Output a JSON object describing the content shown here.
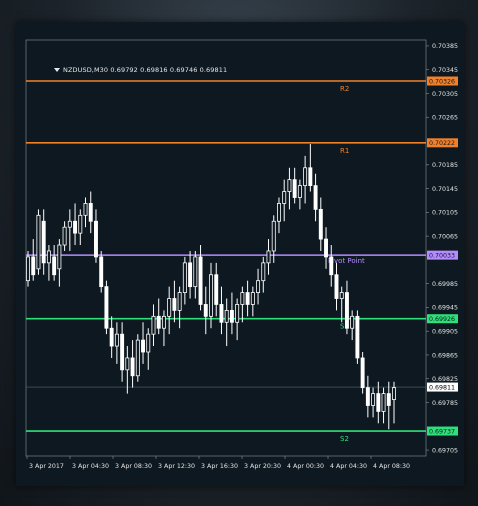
{
  "symbol": "NZDUSD,M30",
  "ohlc": [
    "0.69792",
    "0.69816",
    "0.69746",
    "0.69811"
  ],
  "colors": {
    "background": "#0d1820",
    "candle": "#ffffff",
    "resistance": "#f0812a",
    "pivot": "#b58cff",
    "support": "#2fe07a",
    "axis_text": "#e6e6e6"
  },
  "price_axis": {
    "ticks": [
      "0.70385",
      "0.70345",
      "0.70305",
      "0.70265",
      "0.70185",
      "0.70145",
      "0.70105",
      "0.70065",
      "0.69985",
      "0.69945",
      "0.69905",
      "0.69865",
      "0.69825",
      "0.69785",
      "0.69705"
    ],
    "current_price": "0.69811"
  },
  "time_axis": {
    "labels": [
      "3 Apr 2017",
      "3 Apr 04:30",
      "3 Apr 08:30",
      "3 Apr 12:30",
      "3 Apr 16:30",
      "3 Apr 20:30",
      "4 Apr 00:30",
      "4 Apr 04:30",
      "4 Apr 08:30"
    ]
  },
  "levels": [
    {
      "name": "R2",
      "label": "R2",
      "price": "0.70326",
      "type": "resistance"
    },
    {
      "name": "R1",
      "label": "R1",
      "price": "0.70222",
      "type": "resistance"
    },
    {
      "name": "pivot",
      "label": "Pivot Point",
      "price": "0.70033",
      "type": "pivot"
    },
    {
      "name": "S1",
      "label": "S1",
      "price": "0.69926",
      "type": "support"
    },
    {
      "name": "S2",
      "label": "S2",
      "price": "0.69737",
      "type": "support"
    }
  ],
  "chart_data": {
    "type": "candlestick",
    "ylim": [
      0.69695,
      0.70395
    ],
    "candles": [
      [
        0.6999,
        0.7004,
        0.6998,
        0.7003
      ],
      [
        0.7003,
        0.7006,
        0.6999,
        0.7
      ],
      [
        0.7001,
        0.7011,
        0.7,
        0.701
      ],
      [
        0.7009,
        0.7011,
        0.7,
        0.7002
      ],
      [
        0.7002,
        0.7005,
        0.6999,
        0.7004
      ],
      [
        0.7003,
        0.7005,
        0.6999,
        0.7
      ],
      [
        0.7001,
        0.7006,
        0.6998,
        0.7005
      ],
      [
        0.7005,
        0.7009,
        0.7004,
        0.7008
      ],
      [
        0.7008,
        0.7011,
        0.7004,
        0.7009
      ],
      [
        0.7009,
        0.7012,
        0.7005,
        0.7007
      ],
      [
        0.7007,
        0.7011,
        0.7005,
        0.701
      ],
      [
        0.701,
        0.7013,
        0.7008,
        0.7012
      ],
      [
        0.7012,
        0.7014,
        0.7007,
        0.7009
      ],
      [
        0.7009,
        0.7011,
        0.7002,
        0.7003
      ],
      [
        0.7003,
        0.7004,
        0.6997,
        0.6998
      ],
      [
        0.6998,
        0.6999,
        0.699,
        0.6991
      ],
      [
        0.6991,
        0.6993,
        0.6986,
        0.6988
      ],
      [
        0.6988,
        0.6992,
        0.6985,
        0.699
      ],
      [
        0.699,
        0.6992,
        0.6982,
        0.6984
      ],
      [
        0.6984,
        0.6988,
        0.698,
        0.6986
      ],
      [
        0.6986,
        0.6989,
        0.6981,
        0.6983
      ],
      [
        0.6983,
        0.699,
        0.6982,
        0.6989
      ],
      [
        0.6989,
        0.6992,
        0.6985,
        0.6987
      ],
      [
        0.6987,
        0.6991,
        0.6984,
        0.699
      ],
      [
        0.699,
        0.6995,
        0.6988,
        0.6993
      ],
      [
        0.6993,
        0.6996,
        0.699,
        0.6991
      ],
      [
        0.6991,
        0.6994,
        0.6988,
        0.6993
      ],
      [
        0.6993,
        0.6998,
        0.699,
        0.6996
      ],
      [
        0.6996,
        0.6999,
        0.6992,
        0.6994
      ],
      [
        0.6994,
        0.6998,
        0.6991,
        0.6997
      ],
      [
        0.6997,
        0.7003,
        0.6995,
        0.7002
      ],
      [
        0.7002,
        0.7004,
        0.6996,
        0.6998
      ],
      [
        0.6998,
        0.7004,
        0.6996,
        0.7003
      ],
      [
        0.7003,
        0.7005,
        0.6994,
        0.6995
      ],
      [
        0.6995,
        0.6998,
        0.699,
        0.6993
      ],
      [
        0.6993,
        0.7002,
        0.6991,
        0.7
      ],
      [
        0.7,
        0.7002,
        0.6993,
        0.6995
      ],
      [
        0.6995,
        0.6998,
        0.699,
        0.6992
      ],
      [
        0.6992,
        0.6996,
        0.6988,
        0.6994
      ],
      [
        0.6994,
        0.6997,
        0.699,
        0.6992
      ],
      [
        0.6992,
        0.6996,
        0.6989,
        0.6995
      ],
      [
        0.6995,
        0.6998,
        0.6992,
        0.6997
      ],
      [
        0.6997,
        0.6999,
        0.6993,
        0.6995
      ],
      [
        0.6995,
        0.6998,
        0.6993,
        0.6997
      ],
      [
        0.6997,
        0.7001,
        0.6995,
        0.6999
      ],
      [
        0.6999,
        0.7003,
        0.6997,
        0.7002
      ],
      [
        0.7002,
        0.7006,
        0.7,
        0.7004
      ],
      [
        0.7004,
        0.701,
        0.7002,
        0.7009
      ],
      [
        0.7009,
        0.7013,
        0.7007,
        0.7012
      ],
      [
        0.7012,
        0.7016,
        0.7009,
        0.7014
      ],
      [
        0.7014,
        0.7018,
        0.7011,
        0.7016
      ],
      [
        0.7016,
        0.7018,
        0.7012,
        0.7013
      ],
      [
        0.7013,
        0.7016,
        0.7011,
        0.7015
      ],
      [
        0.7015,
        0.702,
        0.7012,
        0.7018
      ],
      [
        0.7018,
        0.7022,
        0.7014,
        0.7015
      ],
      [
        0.7015,
        0.7017,
        0.7009,
        0.7011
      ],
      [
        0.7011,
        0.7013,
        0.7004,
        0.7006
      ],
      [
        0.7006,
        0.7008,
        0.7001,
        0.7003
      ],
      [
        0.7003,
        0.7005,
        0.6998,
        0.7
      ],
      [
        0.7,
        0.7002,
        0.6994,
        0.6996
      ],
      [
        0.6996,
        0.6998,
        0.6992,
        0.6997
      ],
      [
        0.6997,
        0.6999,
        0.699,
        0.6991
      ],
      [
        0.6991,
        0.6994,
        0.6989,
        0.6993
      ],
      [
        0.6993,
        0.6994,
        0.6985,
        0.6986
      ],
      [
        0.6986,
        0.6987,
        0.698,
        0.6981
      ],
      [
        0.6981,
        0.6983,
        0.6976,
        0.6978
      ],
      [
        0.6978,
        0.6981,
        0.6976,
        0.698
      ],
      [
        0.698,
        0.6982,
        0.6975,
        0.6977
      ],
      [
        0.6977,
        0.6981,
        0.6975,
        0.698
      ],
      [
        0.698,
        0.6982,
        0.6974,
        0.6978
      ],
      [
        0.6979,
        0.6982,
        0.6975,
        0.6981
      ]
    ]
  }
}
